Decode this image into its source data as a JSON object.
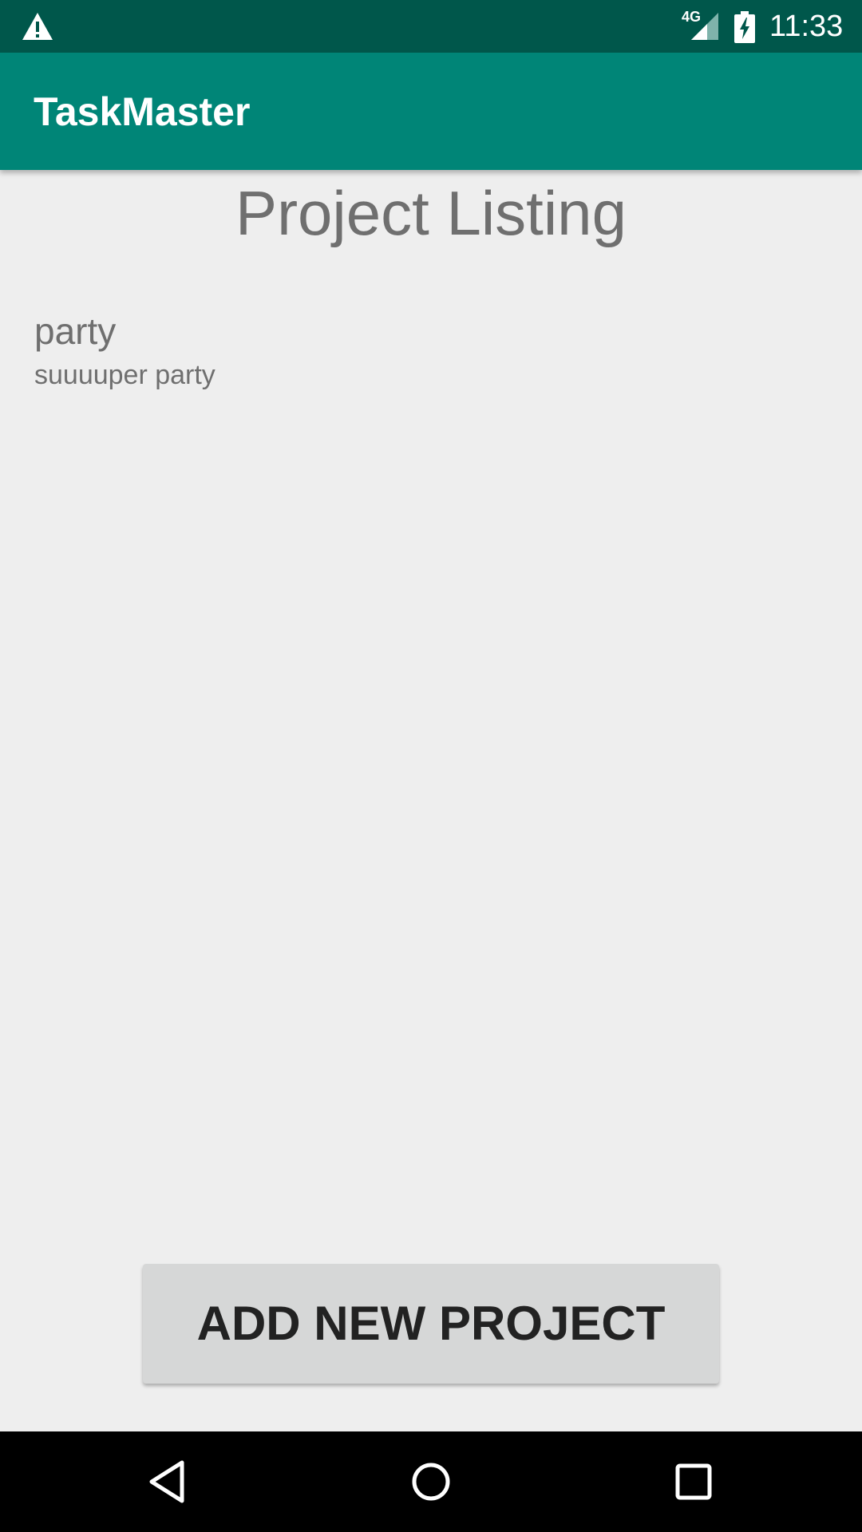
{
  "status_bar": {
    "time": "11:33",
    "network_type": "4G",
    "icons": [
      "warning-icon",
      "cell-signal-icon",
      "battery-charging-icon"
    ]
  },
  "app_bar": {
    "title": "TaskMaster"
  },
  "page": {
    "heading": "Project Listing"
  },
  "projects": [
    {
      "name": "party",
      "description": "suuuuper party"
    }
  ],
  "actions": {
    "add_project_label": "ADD NEW PROJECT"
  },
  "nav_bar": {
    "icons": [
      "back-icon",
      "home-icon",
      "recents-icon"
    ]
  },
  "colors": {
    "status_bar": "#00574b",
    "app_bar": "#008577",
    "background": "#eeeeee",
    "button": "#d6d7d7",
    "text_secondary": "#6f6f6f"
  }
}
